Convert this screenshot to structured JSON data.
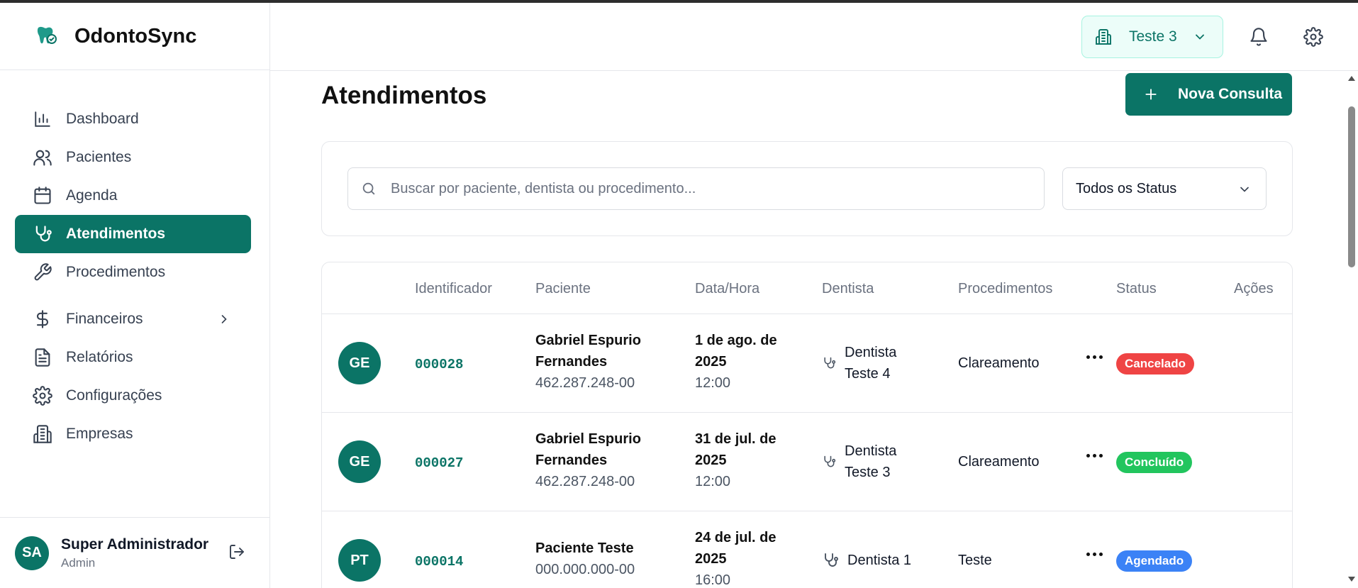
{
  "app": {
    "name": "OdontoSync"
  },
  "sidebar": {
    "items": [
      {
        "label": "Dashboard",
        "icon": "bar-chart-icon"
      },
      {
        "label": "Pacientes",
        "icon": "users-icon"
      },
      {
        "label": "Agenda",
        "icon": "calendar-icon"
      },
      {
        "label": "Atendimentos",
        "icon": "stethoscope-icon",
        "active": true
      },
      {
        "label": "Procedimentos",
        "icon": "wrench-icon"
      },
      {
        "label": "Financeiros",
        "icon": "dollar-icon",
        "expandable": true
      },
      {
        "label": "Relatórios",
        "icon": "file-text-icon"
      },
      {
        "label": "Configurações",
        "icon": "gear-icon"
      },
      {
        "label": "Empresas",
        "icon": "building-icon"
      }
    ]
  },
  "user": {
    "initials": "SA",
    "name": "Super Administrador",
    "role": "Admin"
  },
  "header": {
    "company": "Teste 3"
  },
  "page": {
    "title": "Atendimentos",
    "new_button": "Nova Consulta"
  },
  "filters": {
    "search_placeholder": "Buscar por paciente, dentista ou procedimento...",
    "status": "Todos os Status"
  },
  "table": {
    "columns": [
      "Identificador",
      "Paciente",
      "Data/Hora",
      "Dentista",
      "Procedimentos",
      "Status",
      "Ações"
    ],
    "rows": [
      {
        "initials": "GE",
        "id": "000028",
        "patient_line1": "Gabriel Espurio",
        "patient_line2": "Fernandes",
        "cpf": "462.287.248-00",
        "date_line1": "1 de ago. de",
        "date_line2": "2025",
        "time": "12:00",
        "dentist_line1": "Dentista",
        "dentist_line2": "Teste 4",
        "procedure": "Clareamento",
        "status": "Cancelado"
      },
      {
        "initials": "GE",
        "id": "000027",
        "patient_line1": "Gabriel Espurio",
        "patient_line2": "Fernandes",
        "cpf": "462.287.248-00",
        "date_line1": "31 de jul. de",
        "date_line2": "2025",
        "time": "12:00",
        "dentist_line1": "Dentista",
        "dentist_line2": "Teste 3",
        "procedure": "Clareamento",
        "status": "Concluído"
      },
      {
        "initials": "PT",
        "id": "000014",
        "patient_line1": "Paciente Teste",
        "cpf": "000.000.000-00",
        "date_line1": "24 de jul. de",
        "date_line2": "2025",
        "time": "16:00",
        "dentist_line1": "Dentista 1",
        "procedure": "Teste",
        "status": "Agendado"
      }
    ]
  },
  "colors": {
    "primary": "#0b7466",
    "cancelado": "#ef4444",
    "concluido": "#22c55e",
    "agendado": "#3b82f6"
  }
}
